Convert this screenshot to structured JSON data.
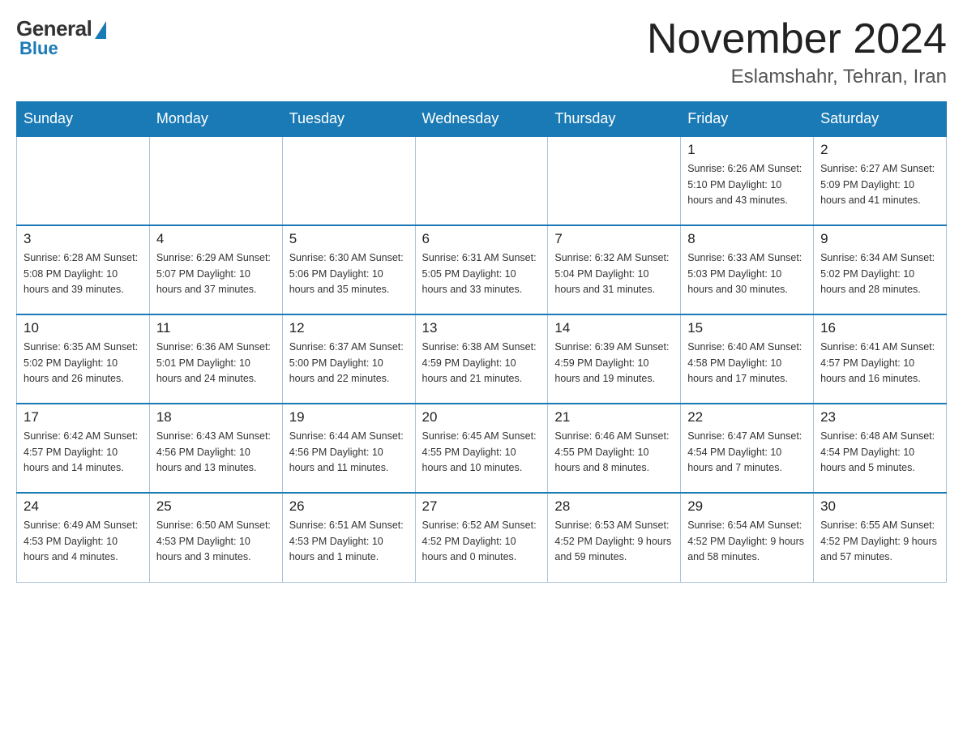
{
  "header": {
    "logo_general": "General",
    "logo_blue": "Blue",
    "month_title": "November 2024",
    "location": "Eslamshahr, Tehran, Iran"
  },
  "weekdays": [
    "Sunday",
    "Monday",
    "Tuesday",
    "Wednesday",
    "Thursday",
    "Friday",
    "Saturday"
  ],
  "weeks": [
    [
      {
        "day": "",
        "info": ""
      },
      {
        "day": "",
        "info": ""
      },
      {
        "day": "",
        "info": ""
      },
      {
        "day": "",
        "info": ""
      },
      {
        "day": "",
        "info": ""
      },
      {
        "day": "1",
        "info": "Sunrise: 6:26 AM\nSunset: 5:10 PM\nDaylight: 10 hours\nand 43 minutes."
      },
      {
        "day": "2",
        "info": "Sunrise: 6:27 AM\nSunset: 5:09 PM\nDaylight: 10 hours\nand 41 minutes."
      }
    ],
    [
      {
        "day": "3",
        "info": "Sunrise: 6:28 AM\nSunset: 5:08 PM\nDaylight: 10 hours\nand 39 minutes."
      },
      {
        "day": "4",
        "info": "Sunrise: 6:29 AM\nSunset: 5:07 PM\nDaylight: 10 hours\nand 37 minutes."
      },
      {
        "day": "5",
        "info": "Sunrise: 6:30 AM\nSunset: 5:06 PM\nDaylight: 10 hours\nand 35 minutes."
      },
      {
        "day": "6",
        "info": "Sunrise: 6:31 AM\nSunset: 5:05 PM\nDaylight: 10 hours\nand 33 minutes."
      },
      {
        "day": "7",
        "info": "Sunrise: 6:32 AM\nSunset: 5:04 PM\nDaylight: 10 hours\nand 31 minutes."
      },
      {
        "day": "8",
        "info": "Sunrise: 6:33 AM\nSunset: 5:03 PM\nDaylight: 10 hours\nand 30 minutes."
      },
      {
        "day": "9",
        "info": "Sunrise: 6:34 AM\nSunset: 5:02 PM\nDaylight: 10 hours\nand 28 minutes."
      }
    ],
    [
      {
        "day": "10",
        "info": "Sunrise: 6:35 AM\nSunset: 5:02 PM\nDaylight: 10 hours\nand 26 minutes."
      },
      {
        "day": "11",
        "info": "Sunrise: 6:36 AM\nSunset: 5:01 PM\nDaylight: 10 hours\nand 24 minutes."
      },
      {
        "day": "12",
        "info": "Sunrise: 6:37 AM\nSunset: 5:00 PM\nDaylight: 10 hours\nand 22 minutes."
      },
      {
        "day": "13",
        "info": "Sunrise: 6:38 AM\nSunset: 4:59 PM\nDaylight: 10 hours\nand 21 minutes."
      },
      {
        "day": "14",
        "info": "Sunrise: 6:39 AM\nSunset: 4:59 PM\nDaylight: 10 hours\nand 19 minutes."
      },
      {
        "day": "15",
        "info": "Sunrise: 6:40 AM\nSunset: 4:58 PM\nDaylight: 10 hours\nand 17 minutes."
      },
      {
        "day": "16",
        "info": "Sunrise: 6:41 AM\nSunset: 4:57 PM\nDaylight: 10 hours\nand 16 minutes."
      }
    ],
    [
      {
        "day": "17",
        "info": "Sunrise: 6:42 AM\nSunset: 4:57 PM\nDaylight: 10 hours\nand 14 minutes."
      },
      {
        "day": "18",
        "info": "Sunrise: 6:43 AM\nSunset: 4:56 PM\nDaylight: 10 hours\nand 13 minutes."
      },
      {
        "day": "19",
        "info": "Sunrise: 6:44 AM\nSunset: 4:56 PM\nDaylight: 10 hours\nand 11 minutes."
      },
      {
        "day": "20",
        "info": "Sunrise: 6:45 AM\nSunset: 4:55 PM\nDaylight: 10 hours\nand 10 minutes."
      },
      {
        "day": "21",
        "info": "Sunrise: 6:46 AM\nSunset: 4:55 PM\nDaylight: 10 hours\nand 8 minutes."
      },
      {
        "day": "22",
        "info": "Sunrise: 6:47 AM\nSunset: 4:54 PM\nDaylight: 10 hours\nand 7 minutes."
      },
      {
        "day": "23",
        "info": "Sunrise: 6:48 AM\nSunset: 4:54 PM\nDaylight: 10 hours\nand 5 minutes."
      }
    ],
    [
      {
        "day": "24",
        "info": "Sunrise: 6:49 AM\nSunset: 4:53 PM\nDaylight: 10 hours\nand 4 minutes."
      },
      {
        "day": "25",
        "info": "Sunrise: 6:50 AM\nSunset: 4:53 PM\nDaylight: 10 hours\nand 3 minutes."
      },
      {
        "day": "26",
        "info": "Sunrise: 6:51 AM\nSunset: 4:53 PM\nDaylight: 10 hours\nand 1 minute."
      },
      {
        "day": "27",
        "info": "Sunrise: 6:52 AM\nSunset: 4:52 PM\nDaylight: 10 hours\nand 0 minutes."
      },
      {
        "day": "28",
        "info": "Sunrise: 6:53 AM\nSunset: 4:52 PM\nDaylight: 9 hours\nand 59 minutes."
      },
      {
        "day": "29",
        "info": "Sunrise: 6:54 AM\nSunset: 4:52 PM\nDaylight: 9 hours\nand 58 minutes."
      },
      {
        "day": "30",
        "info": "Sunrise: 6:55 AM\nSunset: 4:52 PM\nDaylight: 9 hours\nand 57 minutes."
      }
    ]
  ]
}
